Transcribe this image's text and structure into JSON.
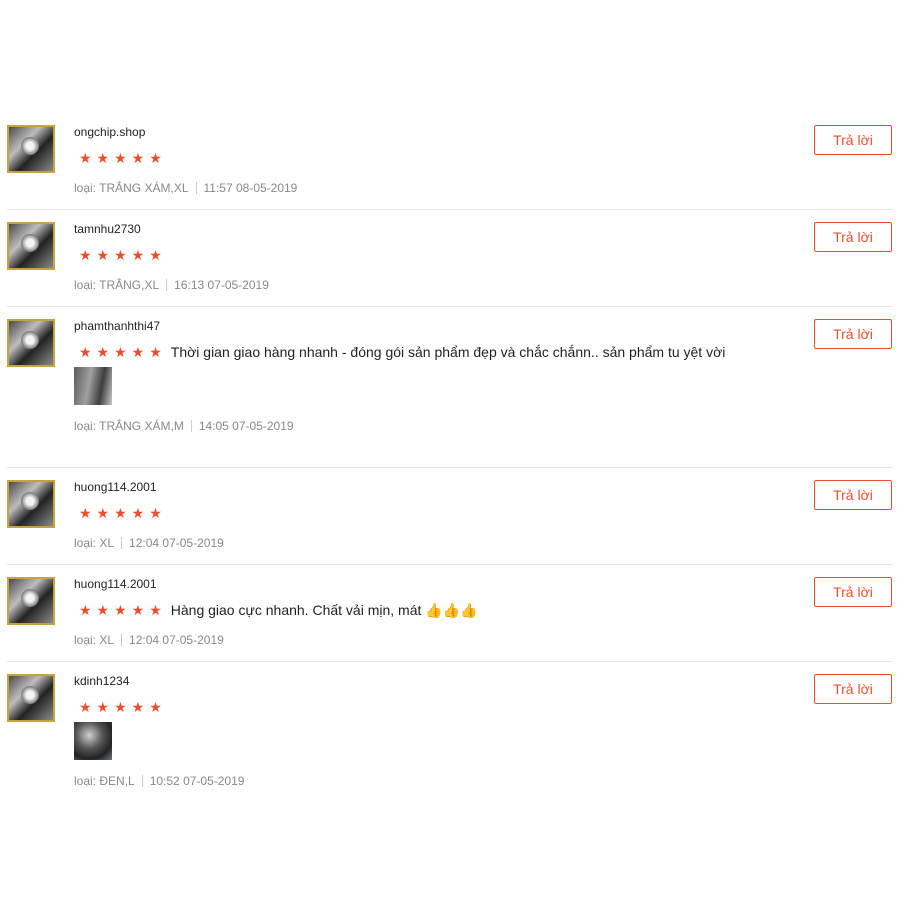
{
  "reply_label": "Trả lời",
  "meta_prefix": "loại:",
  "stars": "★★★★★",
  "accent_color": "#ee4d2d",
  "reviews": [
    {
      "username": "ongchip.shop",
      "rating": 5,
      "comment": "",
      "variant": "TRẮNG XÁM,XL",
      "timestamp": "11:57 08-05-2019"
    },
    {
      "username": "tamnhu2730",
      "rating": 5,
      "comment": "",
      "variant": "TRẮNG,XL",
      "timestamp": "16:13 07-05-2019"
    },
    {
      "username": "phamthanhthi47",
      "rating": 5,
      "comment": "Thời gian giao hàng nhanh - đóng gói sản phẩm đẹp và chắc chắnn.. sản phẩm tu yệt vời",
      "variant": "TRẮNG XÁM,M",
      "timestamp": "14:05 07-05-2019"
    },
    {
      "username": "huong114.2001",
      "rating": 5,
      "comment": "",
      "variant": "XL",
      "timestamp": "12:04 07-05-2019"
    },
    {
      "username": "huong114.2001",
      "rating": 5,
      "comment": "Hàng giao cực nhanh. Chất vải mịn, mát 👍👍👍",
      "variant": "XL",
      "timestamp": "12:04 07-05-2019"
    },
    {
      "username": "kdinh1234",
      "rating": 5,
      "comment": "",
      "variant": "ĐEN,L",
      "timestamp": "10:52 07-05-2019"
    }
  ]
}
